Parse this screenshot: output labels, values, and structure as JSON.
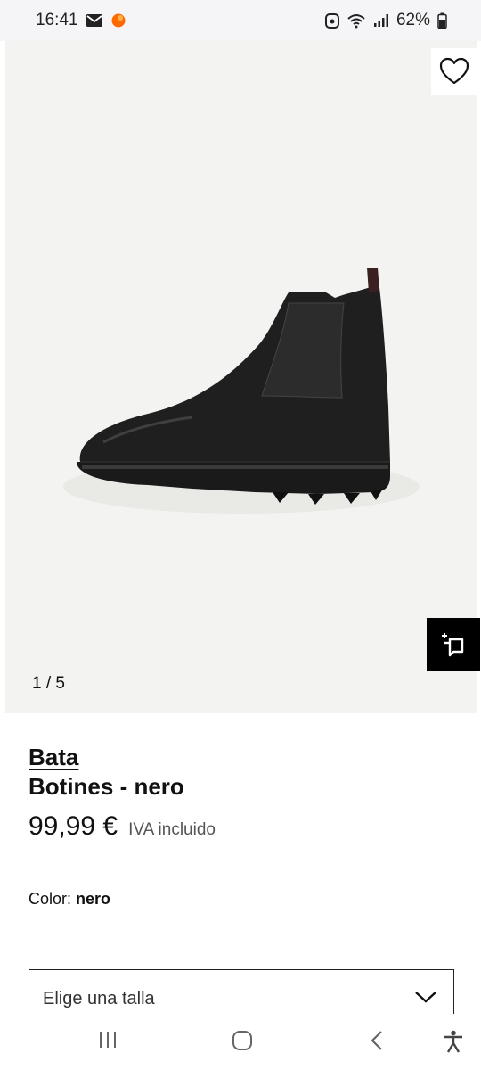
{
  "status_bar": {
    "time": "16:41",
    "battery": "62%",
    "icons": [
      "mail-icon",
      "app-notification-icon",
      "alarm-icon",
      "wifi-icon",
      "signal-icon",
      "battery-icon"
    ]
  },
  "gallery": {
    "counter": "1 / 5",
    "wishlist_icon": "heart-icon",
    "ar_icon": "view-in-room-icon"
  },
  "product": {
    "brand": "Bata",
    "name": "Botines - nero",
    "price": "99,99 €",
    "vat_note": "IVA incluido",
    "color_label": "Color: ",
    "color_value": "nero"
  },
  "size_select": {
    "placeholder": "Elige una talla",
    "icon": "chevron-down-icon"
  },
  "nav_bar": {
    "items": [
      "recent-apps-icon",
      "home-icon",
      "back-icon",
      "accessibility-icon"
    ]
  },
  "colors": {
    "accent": "#000000",
    "background": "#f3f3f1"
  }
}
